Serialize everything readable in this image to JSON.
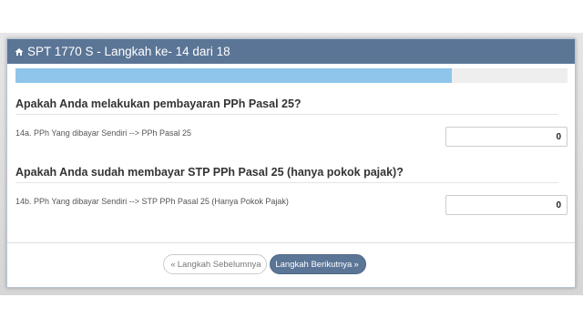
{
  "header": {
    "title": "SPT 1770 S - Langkah ke- 14 dari 18",
    "icon": "home-icon"
  },
  "progress": {
    "value_fraction": 0.79
  },
  "sections": [
    {
      "question": "Apakah Anda melakukan pembayaran PPh Pasal 25?",
      "field_label": "14a. PPh Yang dibayar Sendiri --> PPh Pasal 25",
      "value": "0"
    },
    {
      "question": "Apakah Anda sudah membayar STP PPh Pasal 25 (hanya pokok pajak)?",
      "field_label": "14b. PPh Yang dibayar Sendiri --> STP PPh Pasal 25 (Hanya Pokok Pajak)",
      "value": "0"
    }
  ],
  "footer": {
    "prev_label": "Langkah Sebelumnya",
    "prev_glyph": "«",
    "next_label": "Langkah Berikutnya",
    "next_glyph": "»"
  },
  "colors": {
    "header_bg": "#5b7596",
    "progress_fill": "#8fc5ea",
    "next_button_bg": "#5b7596"
  }
}
